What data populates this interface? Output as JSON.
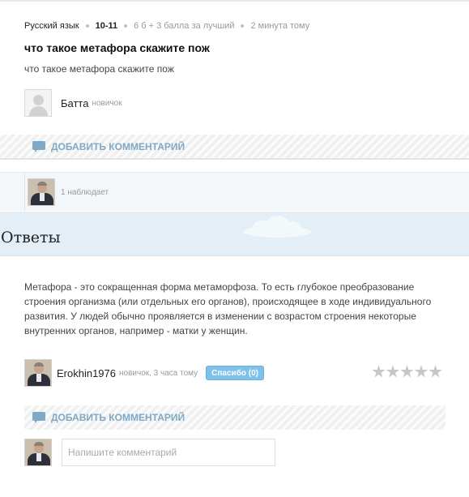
{
  "question": {
    "subject": "Русский язык",
    "grade": "10-11",
    "points": "6 б + 3 балла за лучший",
    "time": "2 минута тому",
    "title": "что такое метафора скажите пож",
    "text": "что такое метафора скажите пож",
    "author": {
      "name": "Батта",
      "rank": "новичок",
      "avatar_icon": "default-user-avatar"
    }
  },
  "add_comment_label": "ДОБАВИТЬ КОММЕНТАРИЙ",
  "watchers": {
    "text": "1 наблюдает"
  },
  "answers_title": "Ответы",
  "answer": {
    "text": "Метафора - это сокращенная форма метаморфоза. То есть глубокое преобразование строения организма (или отдельных его органов), происходящее в ходе индивидуального развития. У людей обычно проявляется в изменении с возрастом строения некоторые внутренних органов, например - матки у женщин.",
    "author": {
      "name": "Erokhin1976",
      "rank": "новичок, 3 часа тому"
    },
    "thanks_label": "Спасибо (0)",
    "rating": 0,
    "rating_max": 5
  },
  "comment_input": {
    "placeholder": "Напишите комментарий",
    "value": ""
  },
  "colors": {
    "accent": "#7fa9c6",
    "thanks_button": "#7ec1ea",
    "band": "#e3eef6",
    "star_empty": "#c7c7c7"
  }
}
